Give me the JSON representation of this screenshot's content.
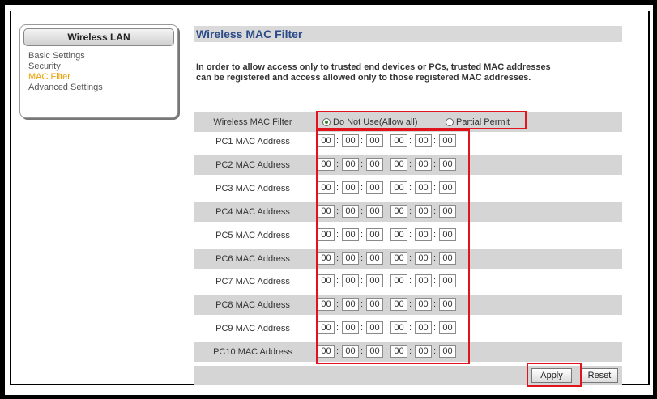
{
  "sidebar": {
    "title": "Wireless LAN",
    "items": [
      {
        "label": "Basic Settings",
        "active": false
      },
      {
        "label": "Security",
        "active": false
      },
      {
        "label": "MAC Filter",
        "active": true
      },
      {
        "label": "Advanced Settings",
        "active": false
      }
    ]
  },
  "page": {
    "title": "Wireless MAC Filter",
    "intro_line1": "In order to allow access only to trusted end devices or PCs, trusted MAC addresses",
    "intro_line2": "can be registered and access allowed only to those registered MAC addresses."
  },
  "filter": {
    "label": "Wireless MAC Filter",
    "options": [
      {
        "label": "Do Not Use(Allow all)",
        "checked": true
      },
      {
        "label": "Partial Permit",
        "checked": false
      }
    ]
  },
  "mac_rows": [
    {
      "label": "PC1 MAC Address",
      "octets": [
        "00",
        "00",
        "00",
        "00",
        "00",
        "00"
      ]
    },
    {
      "label": "PC2 MAC Address",
      "octets": [
        "00",
        "00",
        "00",
        "00",
        "00",
        "00"
      ]
    },
    {
      "label": "PC3 MAC Address",
      "octets": [
        "00",
        "00",
        "00",
        "00",
        "00",
        "00"
      ]
    },
    {
      "label": "PC4 MAC Address",
      "octets": [
        "00",
        "00",
        "00",
        "00",
        "00",
        "00"
      ]
    },
    {
      "label": "PC5 MAC Address",
      "octets": [
        "00",
        "00",
        "00",
        "00",
        "00",
        "00"
      ]
    },
    {
      "label": "PC6 MAC Address",
      "octets": [
        "00",
        "00",
        "00",
        "00",
        "00",
        "00"
      ]
    },
    {
      "label": "PC7 MAC Address",
      "octets": [
        "00",
        "00",
        "00",
        "00",
        "00",
        "00"
      ]
    },
    {
      "label": "PC8 MAC Address",
      "octets": [
        "00",
        "00",
        "00",
        "00",
        "00",
        "00"
      ]
    },
    {
      "label": "PC9 MAC Address",
      "octets": [
        "00",
        "00",
        "00",
        "00",
        "00",
        "00"
      ]
    },
    {
      "label": "PC10 MAC Address",
      "octets": [
        "00",
        "00",
        "00",
        "00",
        "00",
        "00"
      ]
    }
  ],
  "buttons": {
    "apply": "Apply",
    "reset": "Reset"
  },
  "colors": {
    "highlight": "#e0141c",
    "title_text": "#2a4a88",
    "active_menu": "#e8a000",
    "row_shade": "#d5d5d5"
  }
}
